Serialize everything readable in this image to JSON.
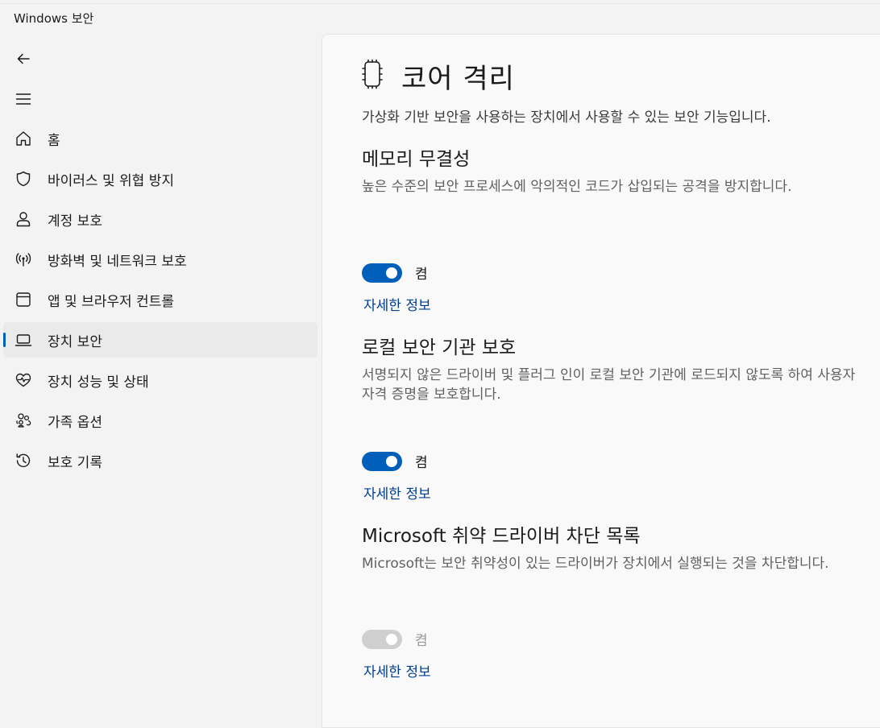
{
  "app": {
    "title": "Windows 보안"
  },
  "nav": {
    "back_icon": "back-arrow-icon",
    "menu_icon": "hamburger-menu-icon",
    "accent": "#005fb8",
    "items": [
      {
        "label": "홈",
        "icon": "home-icon"
      },
      {
        "label": "바이러스 및 위협 방지",
        "icon": "shield-icon"
      },
      {
        "label": "계정 보호",
        "icon": "person-icon"
      },
      {
        "label": "방화벽 및 네트워크 보호",
        "icon": "antenna-icon"
      },
      {
        "label": "앱 및 브라우저 컨트롤",
        "icon": "app-window-icon"
      },
      {
        "label": "장치 보안",
        "icon": "laptop-icon",
        "selected": true
      },
      {
        "label": "장치 성능 및 상태",
        "icon": "heart-pulse-icon"
      },
      {
        "label": "가족 옵션",
        "icon": "family-icon"
      },
      {
        "label": "보호 기록",
        "icon": "history-icon"
      }
    ]
  },
  "page": {
    "icon": "core-isolation-chip-icon",
    "title": "코어 격리",
    "description": "가상화 기반 보안을 사용하는 장치에서 사용할 수 있는 보안 기능입니다."
  },
  "sections": [
    {
      "title": "메모리 무결성",
      "description": "높은 수준의 보안 프로세스에 악의적인 코드가 삽입되는 공격을 방지합니다.",
      "toggle_state": "on",
      "toggle_label": "켬",
      "toggle_enabled": true,
      "link": "자세한 정보"
    },
    {
      "title": "로컬 보안 기관 보호",
      "description": "서명되지 않은 드라이버 및 플러그 인이 로컬 보안 기관에 로드되지 않도록 하여 사용자 자격 증명을 보호합니다.",
      "toggle_state": "on",
      "toggle_label": "켬",
      "toggle_enabled": true,
      "link": "자세한 정보"
    },
    {
      "title": "Microsoft 취약 드라이버 차단 목록",
      "description": "Microsoft는 보안 취약성이 있는 드라이버가 장치에서 실행되는 것을 차단합니다.",
      "toggle_state": "on",
      "toggle_label": "켬",
      "toggle_enabled": false,
      "link": "자세한 정보"
    }
  ]
}
